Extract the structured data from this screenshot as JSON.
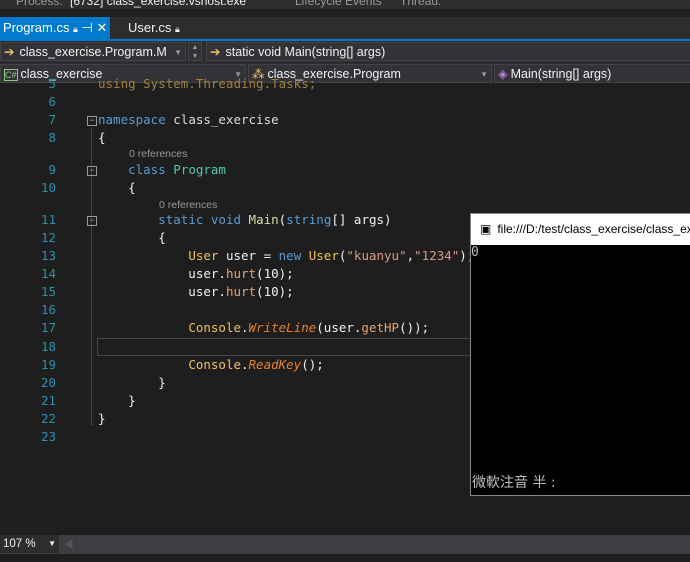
{
  "toolbar": {
    "process_label": "Process:",
    "process_value": "[6732] class_exercise.vshost.exe",
    "lifecycle": "Lifecycle Events",
    "thread_label": "Thread:"
  },
  "tabs": [
    {
      "label": "Program.cs",
      "active": true
    },
    {
      "label": "User.cs",
      "active": false
    }
  ],
  "nav1": {
    "left": "class_exercise.Program.M",
    "right": "static void Main(string[] args)"
  },
  "nav2": {
    "project": "class_exercise",
    "class": "class_exercise.Program",
    "member": "Main(string[] args)"
  },
  "code": {
    "ln5": "5",
    "l5": "using System.Threading.Tasks;",
    "ln6": "6",
    "ln7": "7",
    "ln8": "8",
    "ln9": "9",
    "ln10": "10",
    "ln11": "11",
    "ln12": "12",
    "ln13": "13",
    "ln14": "14",
    "ln15": "15",
    "ln16": "16",
    "ln17": "17",
    "ln18": "18",
    "ln19": "19",
    "ln20": "20",
    "ln21": "21",
    "ln22": "22",
    "ln23": "23",
    "ref1": "0 references",
    "ref2": "0 references"
  },
  "console": {
    "title": "file:///D:/test/class_exercise/class_exercise/bin/Debug/class_exercise.EXE",
    "output": "0",
    "ime": "微軟注音 半 :"
  },
  "status": {
    "zoom": "107 %"
  }
}
